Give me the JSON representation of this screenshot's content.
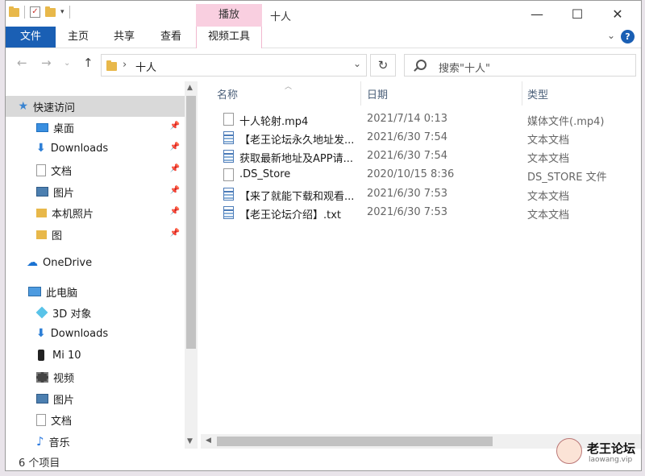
{
  "title_bar": {
    "context_tab": "播放",
    "window_title": "十人",
    "minimize_glyph": "—",
    "maximize_glyph": "☐",
    "close_glyph": "✕"
  },
  "ribbon": {
    "file_tab": "文件",
    "tabs": [
      "主页",
      "共享",
      "查看"
    ],
    "video_tools_tab": "视频工具",
    "help_glyph": "?"
  },
  "address": {
    "path": "十人",
    "search_placeholder": "搜索\"十人\""
  },
  "nav_pane": {
    "quick_access": "快速访问",
    "quick_items": [
      {
        "label": "桌面",
        "icon": "desktop-icon"
      },
      {
        "label": "Downloads",
        "icon": "download-icon"
      },
      {
        "label": "文档",
        "icon": "document-icon"
      },
      {
        "label": "图片",
        "icon": "picture-icon"
      },
      {
        "label": "本机照片",
        "icon": "folder-icon"
      },
      {
        "label": "图",
        "icon": "folder-icon"
      }
    ],
    "onedrive": "OneDrive",
    "this_pc": "此电脑",
    "pc_items": [
      {
        "label": "3D 对象",
        "icon": "3d-objects-icon"
      },
      {
        "label": "Downloads",
        "icon": "download-icon"
      },
      {
        "label": "Mi 10",
        "icon": "phone-icon"
      },
      {
        "label": "视频",
        "icon": "video-icon"
      },
      {
        "label": "图片",
        "icon": "picture-icon"
      },
      {
        "label": "文档",
        "icon": "document-icon"
      },
      {
        "label": "音乐",
        "icon": "music-icon"
      }
    ]
  },
  "file_list": {
    "columns": {
      "name": "名称",
      "date": "日期",
      "type": "类型"
    },
    "rows": [
      {
        "name": "十人轮射.mp4",
        "date": "2021/7/14 0:13",
        "type": "媒体文件(.mp4)",
        "icon": "file-icon"
      },
      {
        "name": "【老王论坛永久地址发...",
        "date": "2021/6/30 7:54",
        "type": "文本文档",
        "icon": "text-file-icon"
      },
      {
        "name": "获取最新地址及APP请...",
        "date": "2021/6/30 7:54",
        "type": "文本文档",
        "icon": "text-file-icon"
      },
      {
        "name": ".DS_Store",
        "date": "2020/10/15 8:36",
        "type": "DS_STORE 文件",
        "icon": "file-icon"
      },
      {
        "name": "【来了就能下载和观看...",
        "date": "2021/6/30 7:53",
        "type": "文本文档",
        "icon": "text-file-icon"
      },
      {
        "name": "【老王论坛介绍】.txt",
        "date": "2021/6/30 7:53",
        "type": "文本文档",
        "icon": "text-file-icon"
      }
    ]
  },
  "status_bar": {
    "item_count": "6 个项目"
  },
  "watermark": {
    "text": "老王论坛",
    "sub": "laowang.vip"
  }
}
